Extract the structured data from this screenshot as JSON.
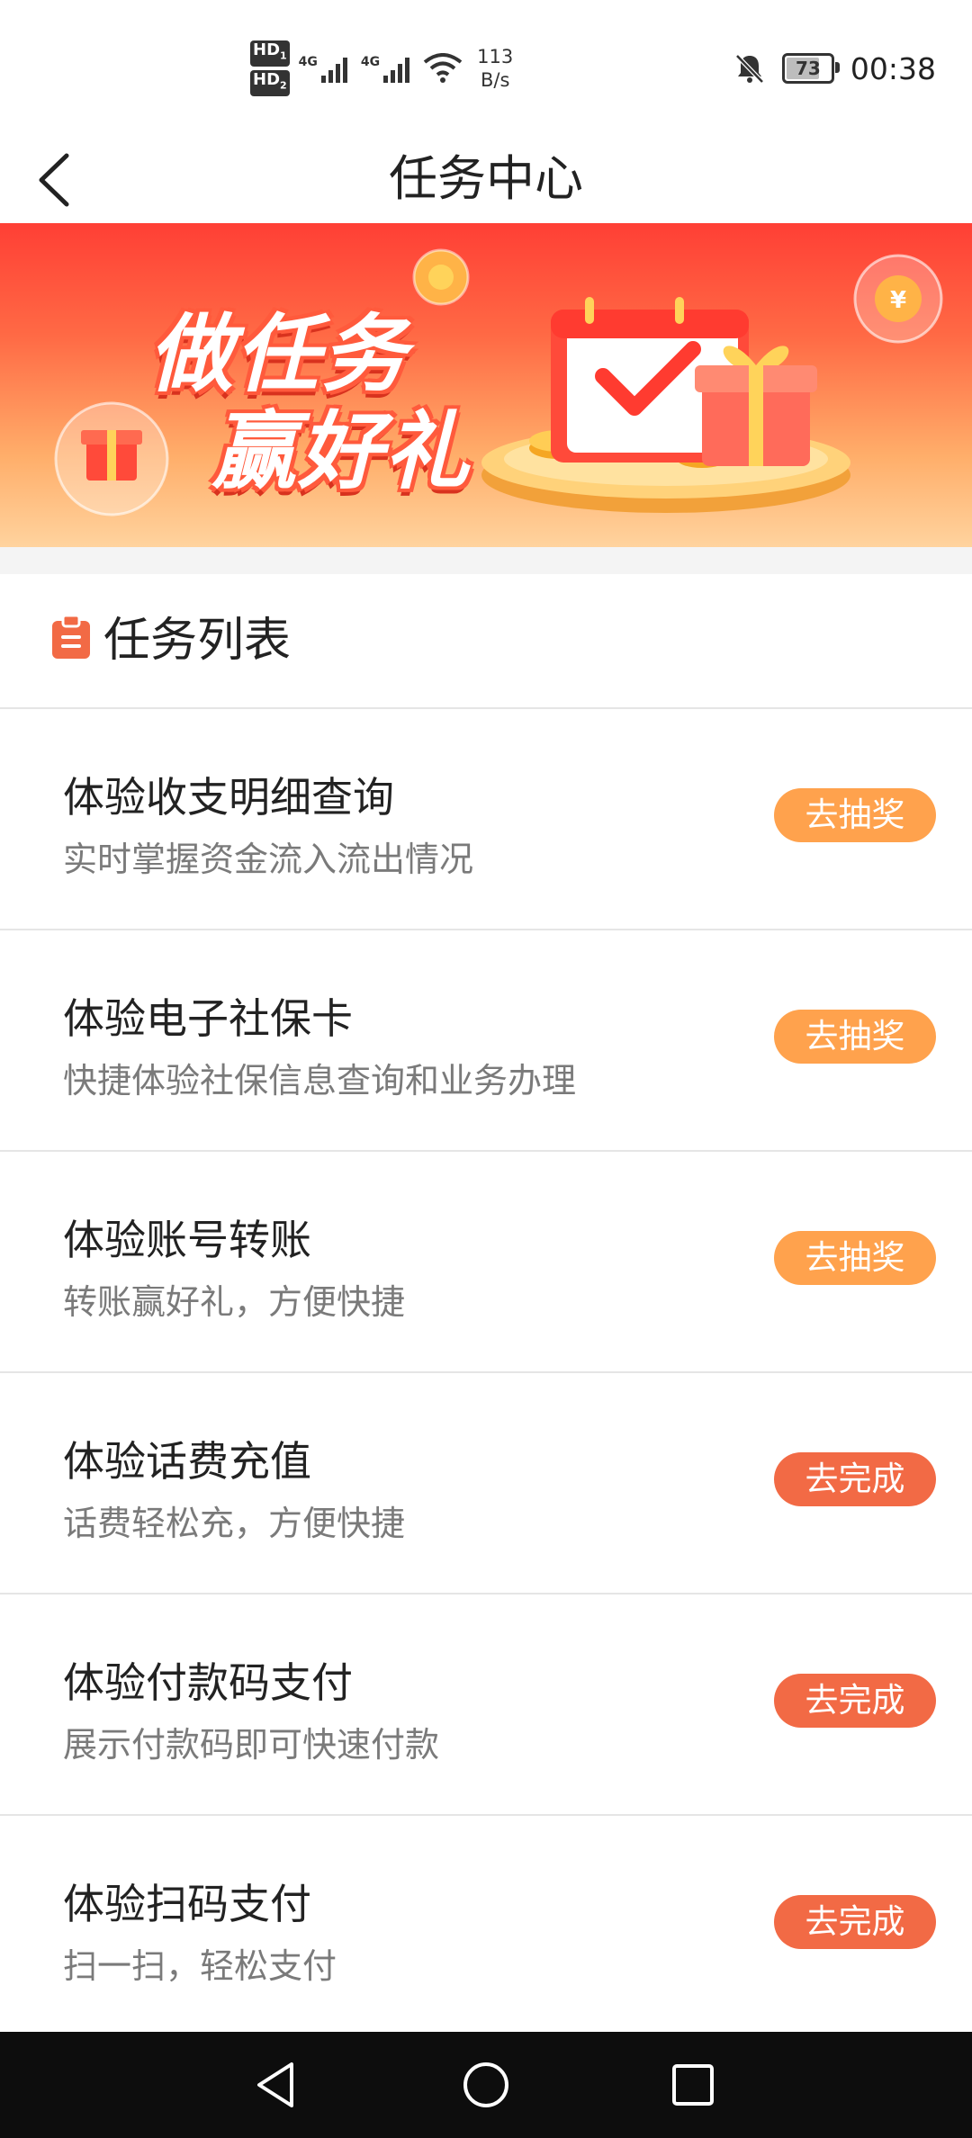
{
  "status_bar": {
    "hd1": "HD",
    "hd1_sub": "1",
    "hd2": "HD",
    "hd2_sub": "2",
    "network1": "4G",
    "network2": "4G",
    "speed_value": "113",
    "speed_unit": "B/s",
    "battery": "73",
    "time": "00:38"
  },
  "header": {
    "title": "任务中心"
  },
  "banner": {
    "line1": "做任务",
    "line2": "赢好礼"
  },
  "section": {
    "title": "任务列表"
  },
  "tasks": [
    {
      "title": "体验收支明细查询",
      "desc": "实时掌握资金流入流出情况",
      "button": "去抽奖",
      "button_color": "#FFA24D"
    },
    {
      "title": "体验电子社保卡",
      "desc": "快捷体验社保信息查询和业务办理",
      "button": "去抽奖",
      "button_color": "#FFA24D"
    },
    {
      "title": "体验账号转账",
      "desc": "转账赢好礼，方便快捷",
      "button": "去抽奖",
      "button_color": "#FFA24D"
    },
    {
      "title": "体验话费充值",
      "desc": "话费轻松充，方便快捷",
      "button": "去完成",
      "button_color": "#F26A45"
    },
    {
      "title": "体验付款码支付",
      "desc": "展示付款码即可快速付款",
      "button": "去完成",
      "button_color": "#F26A45"
    },
    {
      "title": "体验扫码支付",
      "desc": "扫一扫，轻松支付",
      "button": "去完成",
      "button_color": "#F26A45"
    }
  ],
  "colors": {
    "draw_button": "#FFA24D",
    "complete_button": "#F26A45",
    "section_icon": "#F26A45"
  },
  "icons": {
    "back": "back-chevron-icon",
    "section": "clipboard-icon",
    "nav_back": "triangle-back-icon",
    "nav_home": "circle-home-icon",
    "nav_recent": "square-recents-icon"
  }
}
